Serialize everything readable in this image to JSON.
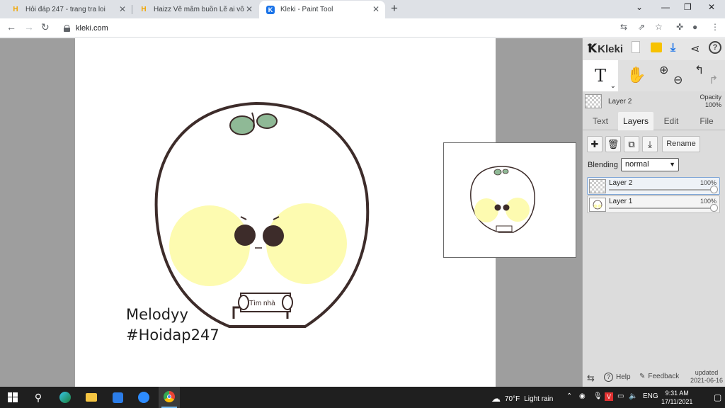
{
  "browser": {
    "tabs": [
      {
        "title": "Hỏi đáp 247 - trang tra loi",
        "active": false
      },
      {
        "title": "Haizz Vẽ mâm buồn Lẽ ai vô nhớ",
        "active": false
      },
      {
        "title": "Kleki - Paint Tool",
        "active": true
      }
    ],
    "url": "kleki.com"
  },
  "canvas": {
    "signature_line1": "Melodyy",
    "signature_line2": "#Hoidap247",
    "sign_text": "Tìm nhà"
  },
  "panel": {
    "logo": "Kleki",
    "current_layer": "Layer 2",
    "opacity_label": "Opacity",
    "opacity_value": "100%",
    "tabs": [
      "Text",
      "Layers",
      "Edit",
      "File"
    ],
    "active_tab": "Layers",
    "rename_label": "Rename",
    "blending_label": "Blending",
    "blending_value": "normal",
    "layers": [
      {
        "name": "Layer 2",
        "opacity": "100%",
        "selected": true
      },
      {
        "name": "Layer 1",
        "opacity": "100%",
        "selected": false
      }
    ],
    "help_label": "Help",
    "feedback_label": "Feedback",
    "updated_label": "updated",
    "updated_date": "2021-06-16"
  },
  "taskbar": {
    "weather_temp": "70°F",
    "weather_desc": "Light rain",
    "lang": "ENG",
    "time": "9:31 AM",
    "date": "17/11/2021"
  },
  "colors": {
    "cheek": "#fdfbb0",
    "leaf": "#8fb996",
    "outline": "#3d2c2a",
    "accent": "#1a73e8"
  }
}
